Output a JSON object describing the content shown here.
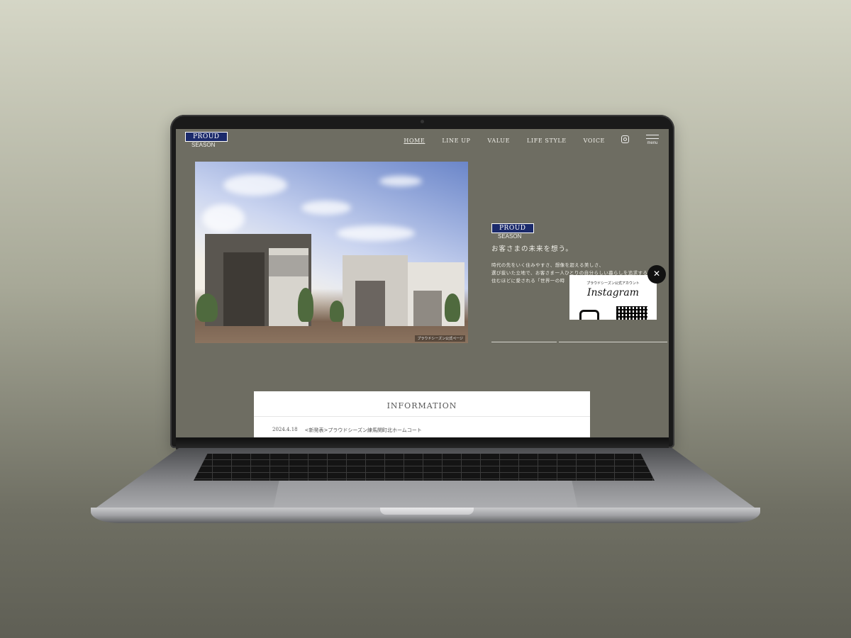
{
  "site": {
    "logo_top": "PROUD",
    "logo_bottom": "SEASON"
  },
  "nav": {
    "items": [
      "HOME",
      "LINE UP",
      "VALUE",
      "LIFE STYLE",
      "VOICE"
    ],
    "active": "HOME",
    "instagram_icon": "instagram-icon",
    "menu_label": "menu"
  },
  "hero": {
    "caption": "プラウドシーズン公式ページ"
  },
  "side": {
    "logo_top": "PROUD",
    "logo_bottom": "SEASON",
    "tagline": "お客さまの未来を想う。",
    "body": "時代の先をいく住みやすさ、想像を超える美しさ、\n選び抜いた立地で、お客さま一人ひとりの自分らしい暮らしを追求する。\n住むほどに愛される「世界一の時"
  },
  "instagram_popup": {
    "small_text": "プラウドシーズン公式アカウント",
    "brand": "Instagram",
    "close_icon": "close-icon"
  },
  "information": {
    "title": "INFORMATION",
    "items": [
      {
        "date": "2024.4.18",
        "text": "<新発表>プラウドシーズン練馬関町北ホームコート"
      }
    ]
  },
  "colors": {
    "page_bg": "#6e6d62",
    "logo_navy": "#1b2a6b",
    "text_light": "#f1f0ea"
  }
}
